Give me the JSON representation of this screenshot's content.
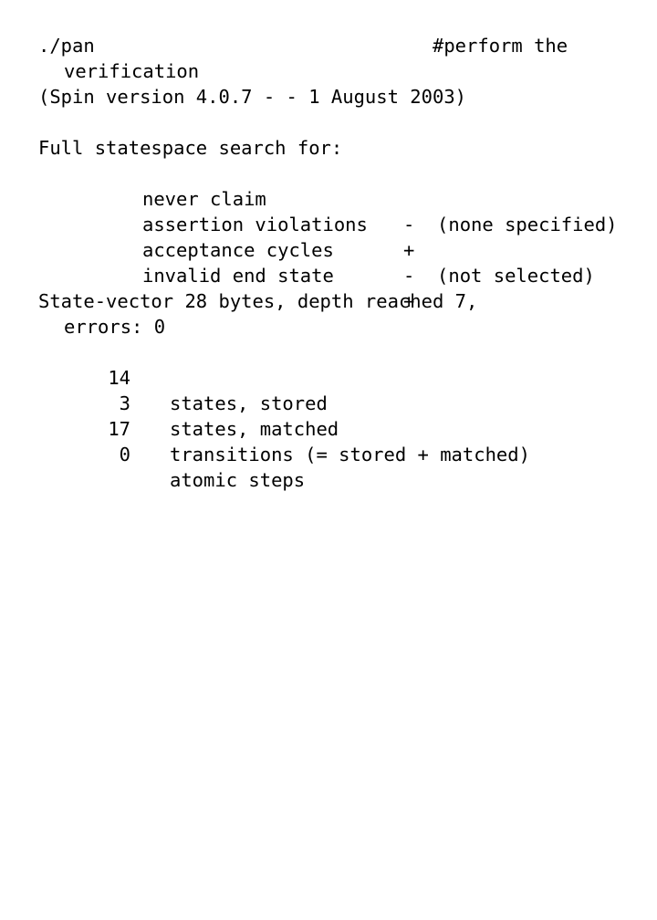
{
  "terminal": {
    "command_line": {
      "command": "./pan",
      "comment": "#perform the",
      "comment_continuation": "verification"
    },
    "version_banner": "(Spin version 4.0.7 - - 1 August 2003)",
    "search_header": "Full statespace search for:",
    "search_options": [
      {
        "label": "never claim",
        "flag": "-  (none specified)"
      },
      {
        "label": "assertion violations",
        "flag": "+"
      },
      {
        "label": "acceptance cycles",
        "flag": "-  (not selected)"
      },
      {
        "label": "invalid end state",
        "flag": "+"
      }
    ],
    "summary_line": "State-vector 28 bytes, depth reached 7,",
    "errors_line": "errors: 0",
    "statistics": [
      {
        "count": "14",
        "label": "states, stored"
      },
      {
        "count": "3",
        "label": "states, matched"
      },
      {
        "count": "17",
        "label": "transitions (= stored + matched)"
      },
      {
        "count": "0",
        "label": "atomic steps"
      }
    ]
  }
}
